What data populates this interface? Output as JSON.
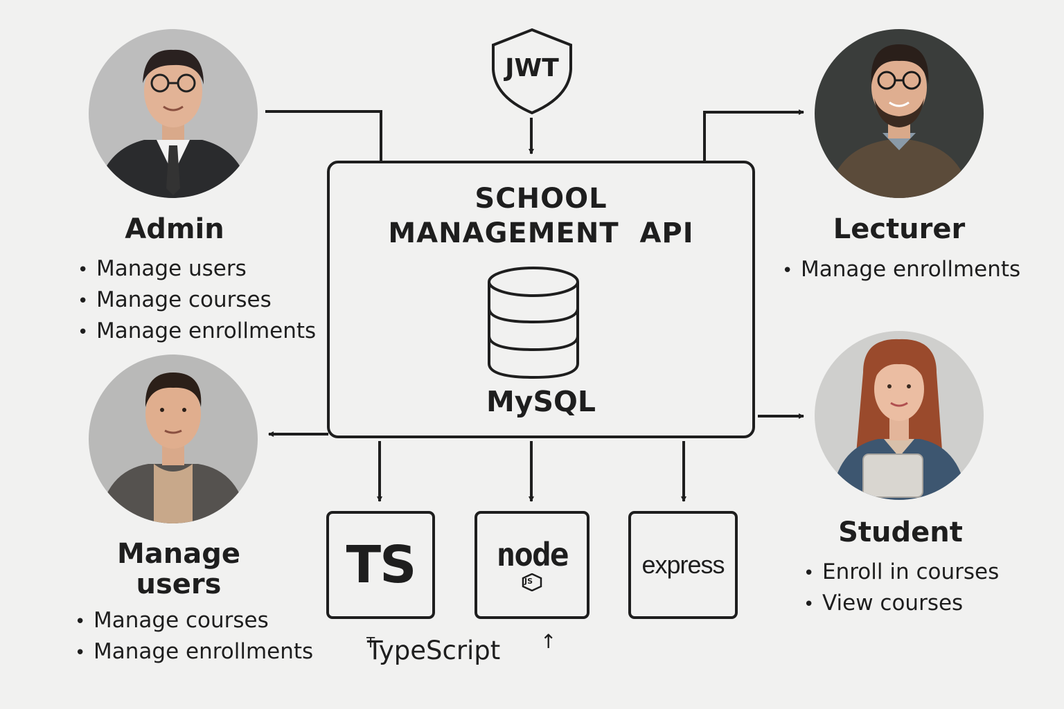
{
  "jwt": {
    "label": "JWT"
  },
  "api": {
    "title_line1": "SCHOOL",
    "title_line2": "MANAGEMENT  API",
    "database": "MySQL"
  },
  "roles": {
    "admin": {
      "title": "Admin",
      "items": [
        "Manage users",
        "Manage courses",
        "Manage enrollments"
      ]
    },
    "lecturer": {
      "title": "Lecturer",
      "items": [
        "Manage enrollments"
      ]
    },
    "manager": {
      "title_line1": "Manage",
      "title_line2": "users",
      "items": [
        "Manage courses",
        "Manage enrollments"
      ]
    },
    "student": {
      "title": "Student",
      "items": [
        "Enroll in courses",
        "View courses"
      ]
    }
  },
  "tech": {
    "typescript_logo": "TS",
    "node_logo": "node",
    "node_badge": "JS",
    "express_logo": "express",
    "typescript_caption": "TypeScript",
    "t_mark": "T",
    "small_arrow": "↑"
  },
  "colors": {
    "ink": "#1e1e1e",
    "background": "#f1f1f0",
    "admin_bg": "#bdbdbd",
    "lecturer_bg": "#3a3d3b",
    "manager_bg": "#b9b9b8",
    "student_bg": "#cfcfcd"
  }
}
